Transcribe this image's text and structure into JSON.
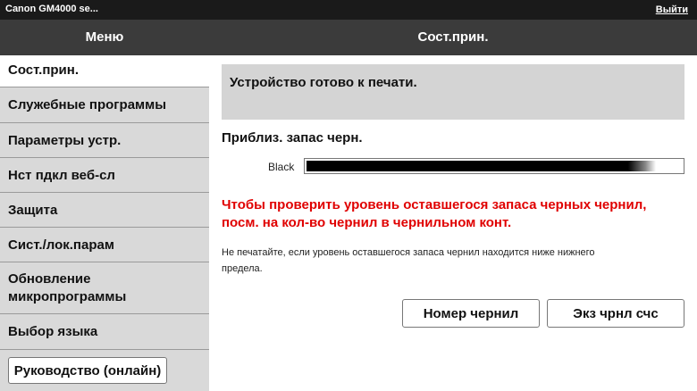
{
  "topbar": {
    "title": "Canon GM4000 se...",
    "logout_label": "Выйти"
  },
  "header": {
    "menu_title": "Меню",
    "page_title": "Сост.прин."
  },
  "sidebar": {
    "items": [
      {
        "label": "Сост.прин.",
        "active": true
      },
      {
        "label": "Служебные программы"
      },
      {
        "label": "Параметры устр."
      },
      {
        "label": "Нст пдкл веб-сл"
      },
      {
        "label": "Защита"
      },
      {
        "label": "Сист./лок.парам"
      },
      {
        "label_line1": "Обновление",
        "label_line2": "микропрограммы"
      },
      {
        "label": "Выбор языка"
      }
    ],
    "manual_button": "Руководство (онлайн)"
  },
  "main": {
    "status_message": "Устройство готово к печати.",
    "ink_heading": "Приблиз. запас черн.",
    "ink": {
      "color_label": "Black",
      "level_percent": 93,
      "bar_color": "#000000"
    },
    "warning_line1": "Чтобы проверить уровень оставшегося запаса черных чернил,",
    "warning_line2": "посм. на кол-во чернил в чернильном конт.",
    "note_line1": "Не печатайте, если уровень оставшегося запаса чернил находится ниже нижнего",
    "note_line2": "предела.",
    "buttons": {
      "ink_model": "Номер чернил",
      "ink_sheet": "Экз чрнл счс"
    }
  },
  "colors": {
    "warning": "#e00000",
    "sidebar_bg": "#d9d9d9",
    "header_bg": "#3b3b3b",
    "topbar_bg": "#1a1a1a"
  }
}
